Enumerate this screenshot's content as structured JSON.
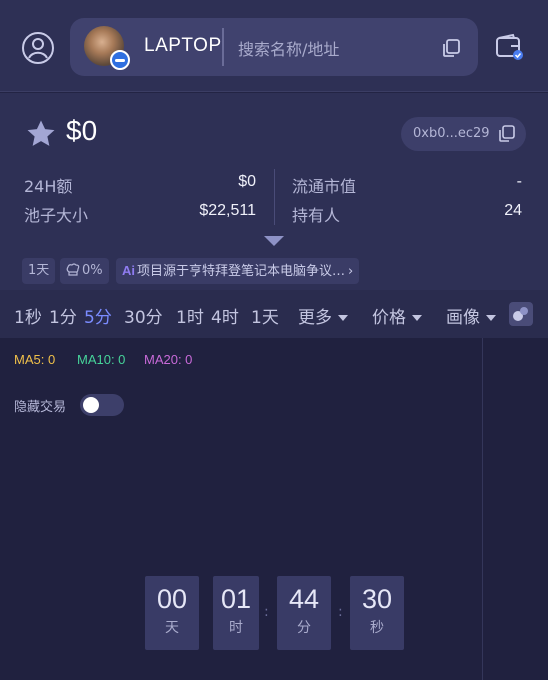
{
  "header": {
    "ticker": "LAPTOP",
    "search_placeholder": "搜索名称/地址"
  },
  "token": {
    "price": "$0",
    "address": "0xb0...ec29",
    "stats": {
      "volume_label": "24H额",
      "volume_value": "$0",
      "pool_label": "池子大小",
      "pool_value": "$22,511",
      "mcap_label": "流通市值",
      "mcap_value": "-",
      "holders_label": "持有人",
      "holders_value": "24"
    },
    "chips": {
      "age": "1天",
      "percent": "0%",
      "ai_label": "Ai",
      "ai_text": "项目源于亨特拜登笔记本电脑争议…"
    }
  },
  "tabs": {
    "items": [
      "1秒",
      "1分",
      "5分",
      "30分",
      "1时",
      "4时",
      "1天"
    ],
    "active": "5分",
    "more": "更多",
    "price": "价格",
    "portrait": "画像"
  },
  "chart": {
    "ma5": "MA5: 0",
    "ma10": "MA10: 0",
    "ma20": "MA20: 0",
    "hide_trades": "隐藏交易",
    "ma5_color": "#f0c04a",
    "ma10_color": "#46d49a",
    "ma20_color": "#c86ad8"
  },
  "countdown": {
    "days": "00",
    "days_unit": "天",
    "hours": "01",
    "hours_unit": "时",
    "minutes": "44",
    "minutes_unit": "分",
    "seconds": "30",
    "seconds_unit": "秒"
  },
  "colors": {
    "background": "#232444",
    "panel": "#2e3055",
    "accent": "#7b8cff"
  }
}
